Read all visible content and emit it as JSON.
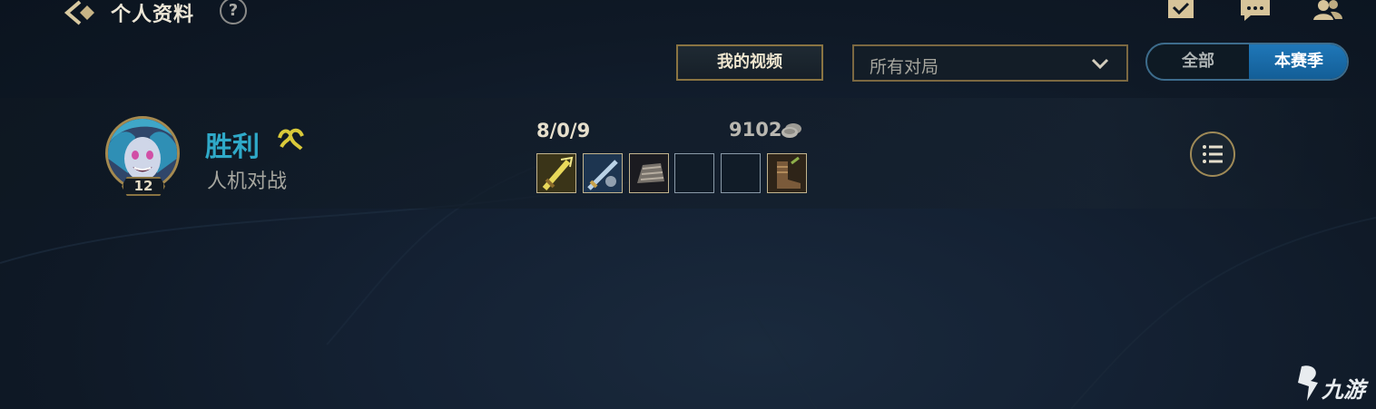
{
  "header": {
    "title": "个人资料",
    "help_label": "?",
    "icons": [
      "checklist-icon",
      "chat-icon",
      "friends-icon"
    ]
  },
  "filters": {
    "video_button_label": "我的视频",
    "match_type_selected": "所有对局",
    "season_toggle": {
      "options": [
        "全部",
        "本赛季"
      ],
      "selected": "本赛季"
    }
  },
  "match": {
    "champion_level": "12",
    "result": "胜利",
    "mode": "人机对战",
    "kda": "8/0/9",
    "gold": "9102",
    "items": [
      "sword-item",
      "dagger-item",
      "gauntlet-item",
      "empty",
      "empty",
      "boots-item"
    ]
  },
  "colors": {
    "victory": "#2fa9c8",
    "gold_accent": "#a58a50",
    "season_active": "#1f77b8"
  },
  "watermark": "九游"
}
